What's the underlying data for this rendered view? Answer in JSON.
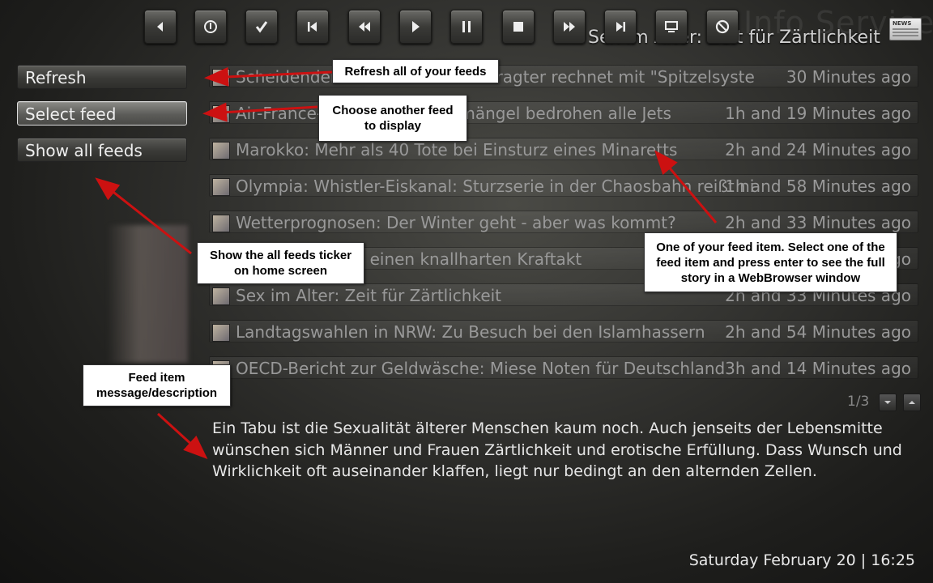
{
  "header": {
    "watermark": "Info Service",
    "window_title": "Sex im Alter: Zeit für Zärtlichkeit",
    "logo_text": "NEWS",
    "controls": [
      {
        "name": "previous-icon"
      },
      {
        "name": "power-icon"
      },
      {
        "name": "check-icon"
      },
      {
        "name": "skip-back-icon"
      },
      {
        "name": "rewind-icon"
      },
      {
        "name": "play-icon"
      },
      {
        "name": "pause-icon"
      },
      {
        "name": "stop-icon"
      },
      {
        "name": "fast-forward-icon"
      },
      {
        "name": "skip-forward-icon"
      },
      {
        "name": "monitor-icon"
      },
      {
        "name": "cancel-icon"
      }
    ]
  },
  "menu": {
    "refresh": "Refresh",
    "select_feed": "Select feed",
    "show_all": "Show all feeds"
  },
  "feeds": [
    {
      "title": "Scheidender Datenschutzbeauftragter rechnet mit \"Spitzelsystem\" im ZDF",
      "time": "30 Minutes ago"
    },
    {
      "title": "Air-France-Chef: Sicherheitsmängel bedrohen alle Jets",
      "time": "1h and 19 Minutes ago"
    },
    {
      "title": "Marokko: Mehr als 40 Tote bei Einsturz eines Minaretts",
      "time": "2h and 24 Minutes ago"
    },
    {
      "title": "Olympia: Whistler-Eiskanal: Sturzserie in der Chaosbahn reißt nicht ab",
      "time": "1h and 58 Minutes ago"
    },
    {
      "title": "Wetterprognosen: Der Winter geht - aber was kommt?",
      "time": "2h and 33 Minutes ago"
    },
    {
      "title": "Wirtschaft plant einen knallharten Kraftakt",
      "time": "2h and 33 Minutes ago"
    },
    {
      "title": "Sex im Alter: Zeit für Zärtlichkeit",
      "time": "2h and 33 Minutes ago"
    },
    {
      "title": "Landtagswahlen in NRW: Zu Besuch bei den Islamhassern",
      "time": "2h and 54 Minutes ago"
    },
    {
      "title": "OECD-Bericht zur Geldwäsche: Miese Noten für Deutschland",
      "time": "3h and 14 Minutes ago"
    }
  ],
  "pager": {
    "label": "1/3"
  },
  "description": "Ein Tabu ist die Sexualität älterer Menschen kaum noch. Auch jenseits der Lebensmitte wünschen sich Männer und Frauen Zärtlichkeit und erotische Erfüllung. Dass Wunsch und Wirklichkeit oft auseinander klaffen, liegt nur bedingt an den alternden Zellen.",
  "footer": {
    "datetime": "Saturday February 20  |  16:25"
  },
  "callouts": {
    "refresh": "Refresh all of your feeds",
    "select": "Choose another feed to display",
    "showall": "Show the all feeds ticker on home screen",
    "feeditem": "One of your feed item. Select one of the feed item and press enter to see the full story in a WebBrowser window",
    "description": "Feed item message/description"
  },
  "colors": {
    "accent_arrow": "#cc1111",
    "background": "#2b2b29"
  }
}
